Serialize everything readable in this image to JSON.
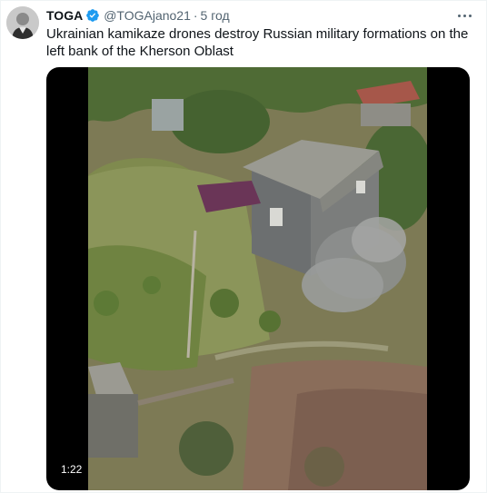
{
  "tweet": {
    "display_name": "TOGA",
    "handle": "@TOGAjano21",
    "separator": "·",
    "time": "5 год",
    "text": "Ukrainian kamikaze drones destroy Russian military formations on the left bank of the Kherson Oblast",
    "media": {
      "duration": "1:22"
    }
  },
  "icons": {
    "verified": "verified-badge-icon",
    "more": "more-options-icon"
  },
  "colors": {
    "verified_blue": "#1d9bf0",
    "secondary_text": "#536471",
    "primary_text": "#0f1419"
  }
}
